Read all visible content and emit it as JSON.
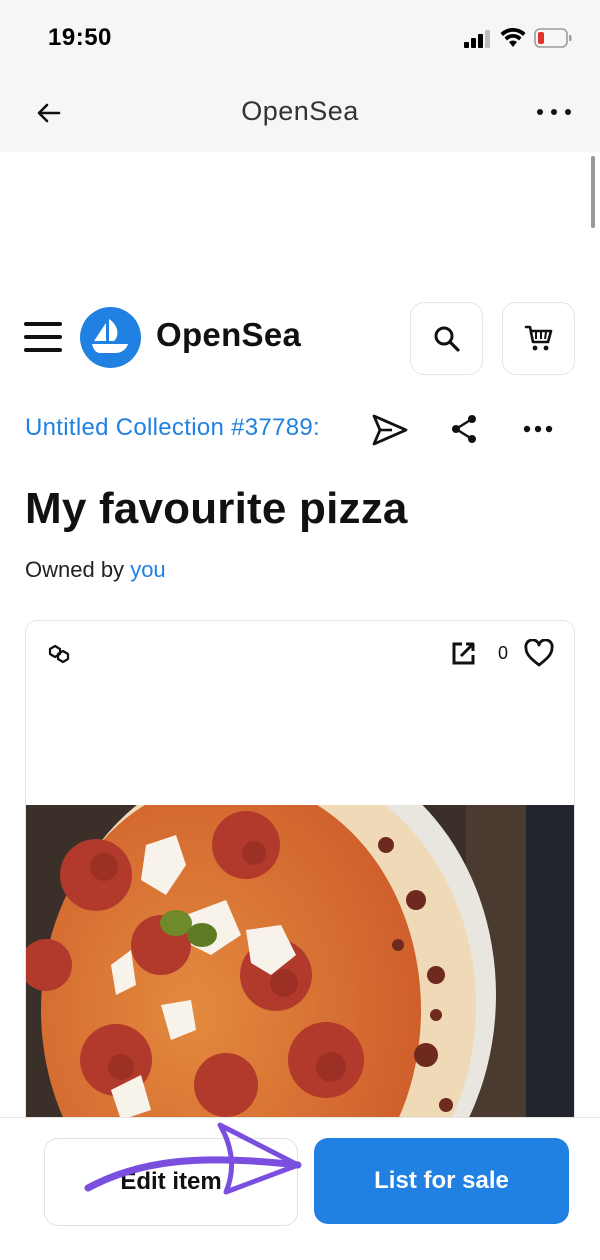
{
  "status_bar": {
    "time": "19:50"
  },
  "browser": {
    "title": "OpenSea"
  },
  "site": {
    "brand": "OpenSea"
  },
  "collection": {
    "name": "Untitled Collection #37789:"
  },
  "item": {
    "title": "My favourite pizza",
    "owned_prefix": "Owned by",
    "owner": "you",
    "favorites_count": "0"
  },
  "actions": {
    "edit_label": "Edit item",
    "list_label": "List for sale"
  },
  "colors": {
    "accent": "#2081e2",
    "annotation": "#7a4fe0"
  },
  "icons": [
    "back-arrow-icon",
    "more-dots-icon",
    "menu-icon",
    "search-icon",
    "cart-icon",
    "send-icon",
    "share-icon",
    "chain-icon",
    "external-link-icon",
    "heart-icon"
  ]
}
